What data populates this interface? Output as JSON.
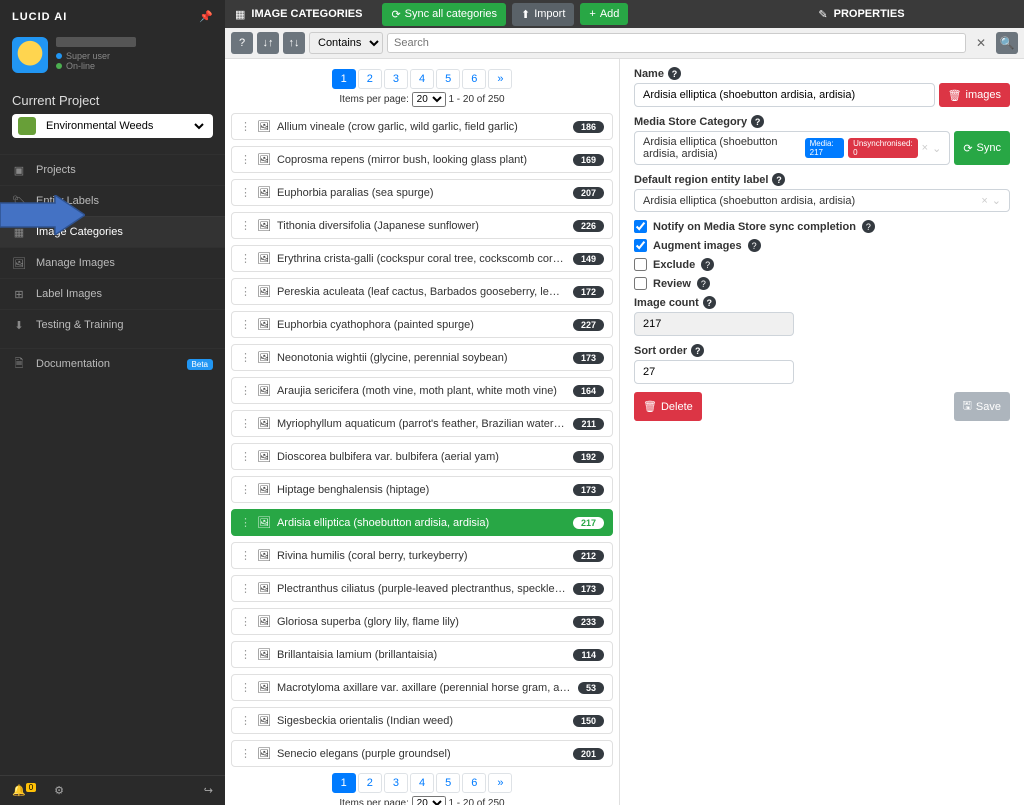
{
  "brand": "LUCID AI",
  "user": {
    "status1": "Super user",
    "status2": "On-line"
  },
  "section": "Current Project",
  "project": "Environmental Weeds",
  "nav": [
    {
      "label": "Projects"
    },
    {
      "label": "Entity Labels"
    },
    {
      "label": "Image Categories"
    },
    {
      "label": "Manage Images"
    },
    {
      "label": "Label Images"
    },
    {
      "label": "Testing & Training"
    },
    {
      "label": "Documentation"
    }
  ],
  "beta_badge": "Beta",
  "notif_count": "0",
  "topbar": {
    "categories_title": "IMAGE CATEGORIES",
    "sync_all": "Sync all categories",
    "import": "Import",
    "add": "Add",
    "properties_title": "PROPERTIES"
  },
  "toolbar": {
    "filter_mode": "Contains",
    "search_placeholder": "Search"
  },
  "pager": {
    "pages": [
      "1",
      "2",
      "3",
      "4",
      "5",
      "6",
      "»"
    ],
    "items_per_page_label": "Items per page:",
    "items_per_page": "20",
    "range": "1 - 20 of 250"
  },
  "categories": [
    {
      "name": "Allium vineale (crow garlic, wild garlic, field garlic)",
      "count": "186"
    },
    {
      "name": "Coprosma repens (mirror bush, looking glass plant)",
      "count": "169"
    },
    {
      "name": "Euphorbia paralias (sea spurge)",
      "count": "207"
    },
    {
      "name": "Tithonia diversifolia (Japanese sunflower)",
      "count": "226"
    },
    {
      "name": "Erythrina crista-galli (cockspur coral tree, cockscomb coral tree)",
      "count": "149"
    },
    {
      "name": "Pereskia aculeata (leaf cactus, Barbados gooseberry, lemon vine, blade apple)",
      "count": "172"
    },
    {
      "name": "Euphorbia cyathophora (painted spurge)",
      "count": "227"
    },
    {
      "name": "Neonotonia wightii (glycine, perennial soybean)",
      "count": "173"
    },
    {
      "name": "Araujia sericifera (moth vine, moth plant, white moth vine)",
      "count": "164"
    },
    {
      "name": "Myriophyllum aquaticum (parrot's feather, Brazilian water-milfoil)",
      "count": "211"
    },
    {
      "name": "Dioscorea bulbifera var. bulbifera (aerial yam)",
      "count": "192"
    },
    {
      "name": "Hiptage benghalensis (hiptage)",
      "count": "173"
    },
    {
      "name": "Ardisia elliptica (shoebutton ardisia, ardisia)",
      "count": "217",
      "selected": true
    },
    {
      "name": "Rivina humilis (coral berry, turkeyberry)",
      "count": "212"
    },
    {
      "name": "Plectranthus ciliatus (purple-leaved plectranthus, speckled spur flower)",
      "count": "173"
    },
    {
      "name": "Gloriosa superba (glory lily, flame lily)",
      "count": "233"
    },
    {
      "name": "Brillantaisia lamium (brillantaisia)",
      "count": "114"
    },
    {
      "name": "Macrotyloma axillare var. axillare (perennial horse gram, axillaris)",
      "count": "53"
    },
    {
      "name": "Sigesbeckia orientalis (Indian weed)",
      "count": "150"
    },
    {
      "name": "Senecio elegans (purple groundsel)",
      "count": "201"
    }
  ],
  "props": {
    "name_label": "Name",
    "name_value": "Ardisia elliptica (shoebutton ardisia, ardisia)",
    "images_btn": "images",
    "media_label": "Media Store Category",
    "media_value": "Ardisia elliptica (shoebutton ardisia, ardisia)",
    "media_badge1": "Media: 217",
    "media_badge2": "Unsynchronised: 0",
    "sync_btn": "Sync",
    "region_label": "Default region entity label",
    "region_value": "Ardisia elliptica (shoebutton ardisia, ardisia)",
    "notify_label": "Notify on Media Store sync completion",
    "augment_label": "Augment images",
    "exclude_label": "Exclude",
    "review_label": "Review",
    "count_label": "Image count",
    "count_value": "217",
    "sort_label": "Sort order",
    "sort_value": "27",
    "delete_btn": "Delete",
    "save_btn": "Save"
  }
}
